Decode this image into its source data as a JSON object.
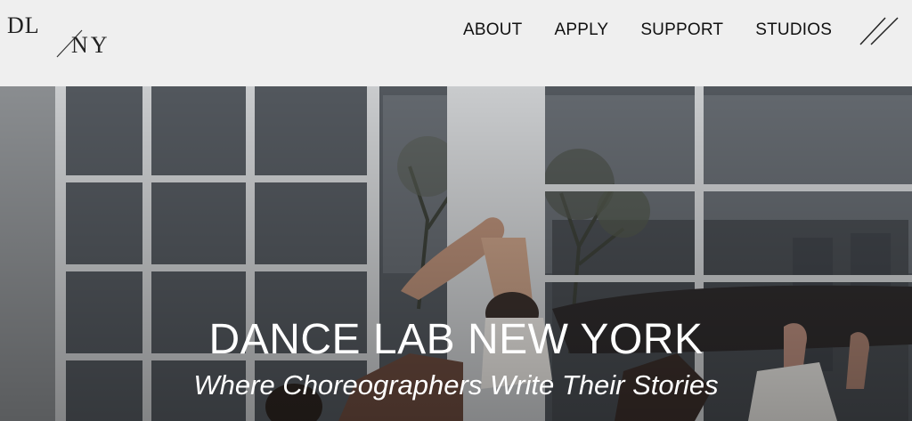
{
  "logo": {
    "top": "DL",
    "bottom": "NY"
  },
  "nav": {
    "items": [
      "ABOUT",
      "APPLY",
      "SUPPORT",
      "STUDIOS"
    ]
  },
  "menu": {
    "icon": "menu-icon"
  },
  "hero": {
    "title": "DANCE LAB NEW YORK",
    "subtitle": "Where Choreographers Write Their Stories"
  }
}
